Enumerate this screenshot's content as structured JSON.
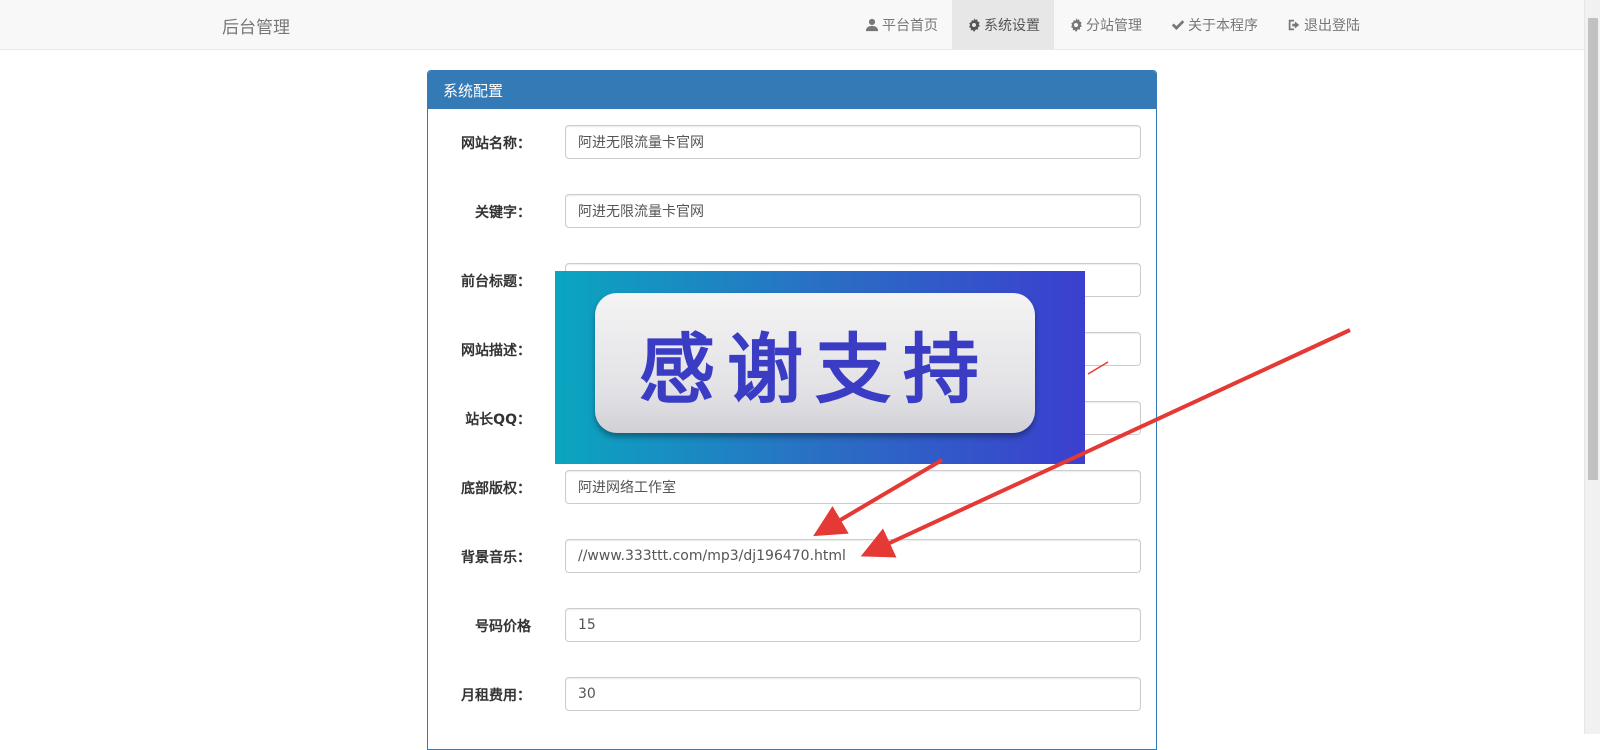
{
  "brand": "后台管理",
  "nav": [
    {
      "label": "平台首页",
      "icon": "user-icon",
      "active": false
    },
    {
      "label": "系统设置",
      "icon": "gear-icon",
      "active": true
    },
    {
      "label": "分站管理",
      "icon": "gear-icon",
      "active": false
    },
    {
      "label": "关于本程序",
      "icon": "check-icon",
      "active": false
    },
    {
      "label": "退出登陆",
      "icon": "logout-icon",
      "active": false
    }
  ],
  "panel": {
    "title": "系统配置",
    "fields": [
      {
        "label": "网站名称：",
        "value": "阿进无限流量卡官网"
      },
      {
        "label": "关键字：",
        "value": "阿进无限流量卡官网"
      },
      {
        "label": "前台标题：",
        "value": ""
      },
      {
        "label": "网站描述：",
        "value": ""
      },
      {
        "label": "站长QQ：",
        "value": ""
      },
      {
        "label": "底部版权：",
        "value": "阿进网络工作室"
      },
      {
        "label": "背景音乐：",
        "value": "//www.333ttt.com/mp3/dj196470.html"
      },
      {
        "label": "号码价格",
        "value": "15"
      },
      {
        "label": "月租费用：",
        "value": "30"
      }
    ]
  },
  "promo_text": "感谢支持",
  "colors": {
    "panel_primary": "#337ab7",
    "arrow": "#e53935",
    "promo_text": "#3b3cc4"
  }
}
